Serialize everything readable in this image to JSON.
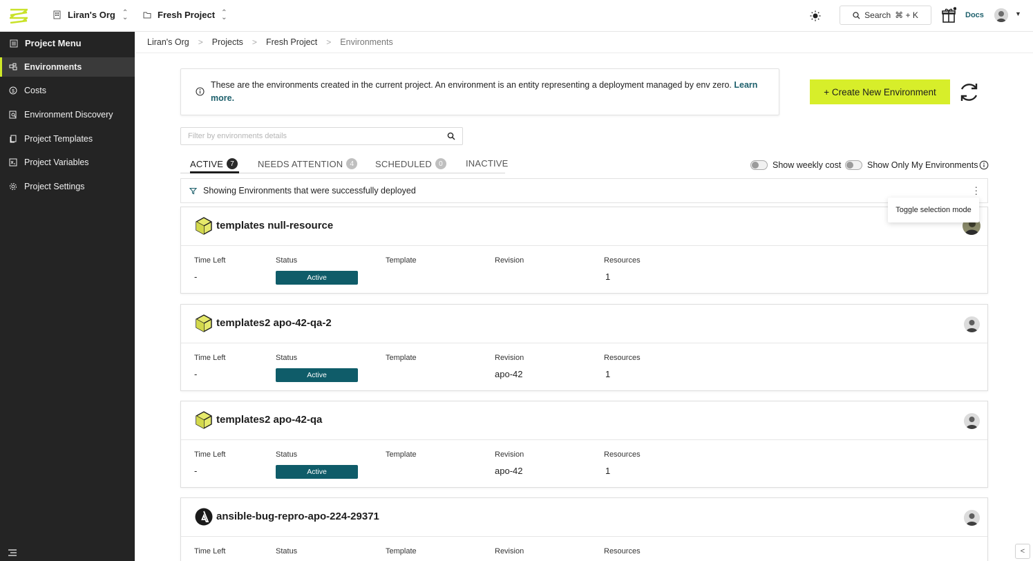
{
  "topbar": {
    "org_name": "Liran's Org",
    "project_name": "Fresh Project",
    "search_label": "Search",
    "search_shortcut": "⌘ + K",
    "docs_label": "Docs"
  },
  "sidebar": {
    "header": "Project Menu",
    "items": [
      {
        "label": "Environments",
        "icon": "environments-icon",
        "active": true
      },
      {
        "label": "Costs",
        "icon": "costs-icon"
      },
      {
        "label": "Environment Discovery",
        "icon": "discovery-icon"
      },
      {
        "label": "Project Templates",
        "icon": "templates-icon"
      },
      {
        "label": "Project Variables",
        "icon": "variables-icon"
      },
      {
        "label": "Project Settings",
        "icon": "settings-icon"
      }
    ]
  },
  "breadcrumb": [
    "Liran's Org",
    "Projects",
    "Fresh Project",
    "Environments"
  ],
  "info": {
    "text": "These are the environments created in the current project. An environment is an entity representing a deployment managed by env zero.",
    "link": "Learn more."
  },
  "create_button": "+ Create New Environment",
  "filter": {
    "placeholder": "Filter by environments details"
  },
  "tabs": [
    {
      "label": "ACTIVE",
      "count": "7"
    },
    {
      "label": "NEEDS ATTENTION",
      "count": "4"
    },
    {
      "label": "SCHEDULED",
      "count": "0"
    },
    {
      "label": "INACTIVE",
      "count": ""
    }
  ],
  "toggles": {
    "weekly_cost": "Show weekly cost",
    "only_mine": "Show Only My Environments"
  },
  "strip_text": "Showing Environments that were successfully deployed",
  "tooltip": "Toggle selection mode",
  "columns": {
    "time_left": "Time Left",
    "status": "Status",
    "template": "Template",
    "revision": "Revision",
    "resources": "Resources"
  },
  "environments": [
    {
      "name": "templates null-resource",
      "time_left": "-",
      "status": "Active",
      "template": "",
      "revision": "",
      "resources": "1",
      "icon": "terraform-cube-icon"
    },
    {
      "name": "templates2 apo-42-qa-2",
      "time_left": "-",
      "status": "Active",
      "template": "",
      "revision": "apo-42",
      "resources": "1",
      "icon": "terraform-cube-icon"
    },
    {
      "name": "templates2 apo-42-qa",
      "time_left": "-",
      "status": "Active",
      "template": "",
      "revision": "apo-42",
      "resources": "1",
      "icon": "terraform-cube-icon"
    },
    {
      "name": "ansible-bug-repro-apo-224-29371",
      "time_left": "",
      "status": "",
      "template": "",
      "revision": "",
      "resources": "",
      "icon": "ansible-icon"
    }
  ],
  "colors": {
    "accent": "#d7ee2a",
    "status_active": "#0f5c69",
    "sidebar_bg": "#242424",
    "link": "#1c5f6b"
  }
}
